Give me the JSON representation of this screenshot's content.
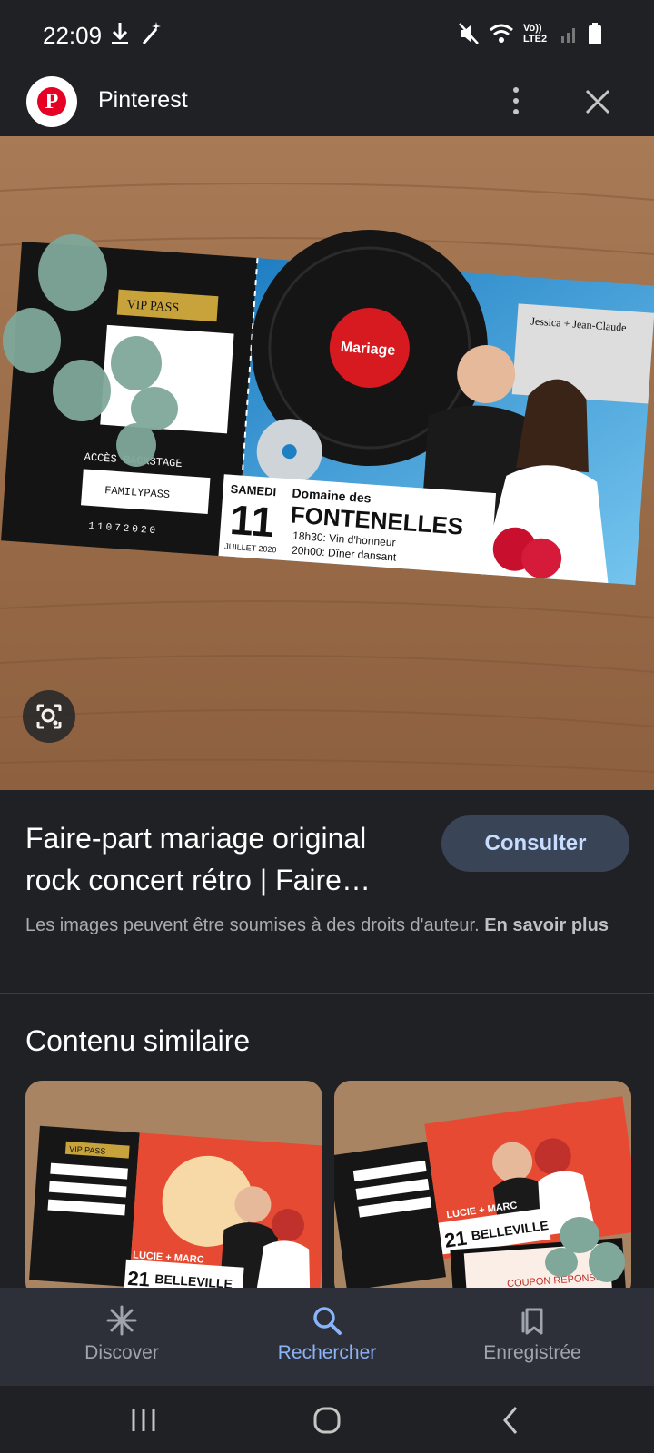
{
  "status": {
    "time": "22:09",
    "network": "Vo)) LTE2"
  },
  "app": {
    "title": "Pinterest",
    "logo_letter": "P"
  },
  "hero_image": {
    "ticket": {
      "vip": "VIP PASS",
      "couple": "Jessica + Jean-Claude",
      "vinyl": "Mariage",
      "day": "SAMEDI",
      "date_number": "11",
      "month": "JUILLET 2020",
      "venue_line1": "Domaine des",
      "venue_line2": "FONTENELLES",
      "schedule_1": "18h30: Vin d'honneur",
      "schedule_2": "20h00: Dîner dansant",
      "backstage": "ACCÈS BACKSTAGE",
      "pass": "FAMILYPASS",
      "serial": "11072020"
    }
  },
  "result": {
    "title": "Faire-part mariage original rock concert rétro | Faire…",
    "consult_label": "Consulter",
    "rights_text": "Les images peuvent être soumises à des droits d'auteur.",
    "rights_link": "En savoir plus"
  },
  "similar": {
    "title": "Contenu similaire",
    "items": [
      {
        "date": "21",
        "venue": "BELLEVILLE",
        "names": "LUCIE + MARC",
        "vip": "VIP PASS"
      },
      {
        "date": "21",
        "venue": "BELLEVILLE",
        "names": "LUCIE + MARC",
        "coupon": "COUPON RÉPONSE"
      }
    ]
  },
  "bottom_nav": {
    "items": [
      {
        "label": "Discover"
      },
      {
        "label": "Rechercher"
      },
      {
        "label": "Enregistrée"
      }
    ],
    "active_color": "#8ab4f8"
  }
}
